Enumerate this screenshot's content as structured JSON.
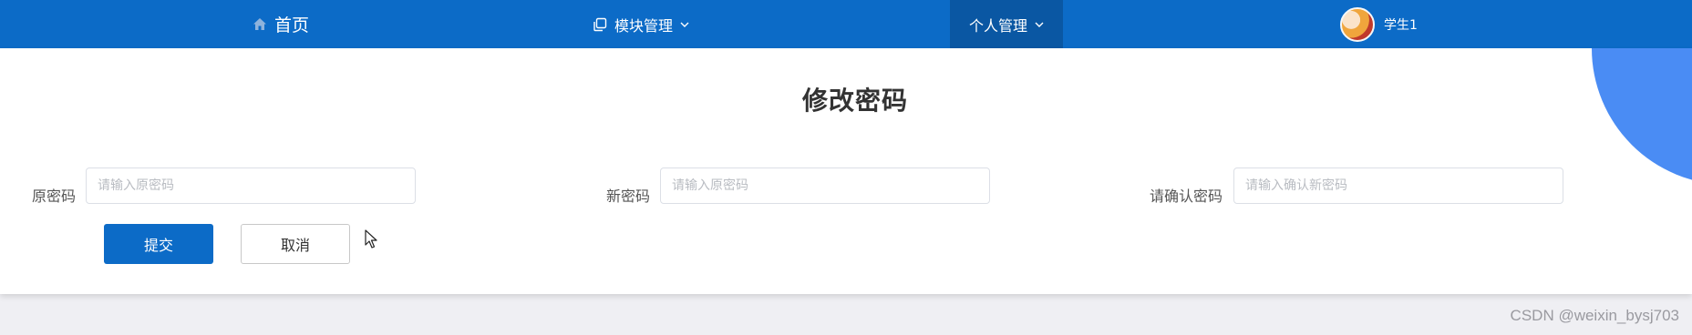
{
  "nav": {
    "home_label": "首页",
    "modules_label": "模块管理",
    "personal_label": "个人管理",
    "user_name": "学生1"
  },
  "page": {
    "title": "修改密码"
  },
  "form": {
    "old_password": {
      "label": "原密码",
      "placeholder": "请输入原密码",
      "value": ""
    },
    "new_password": {
      "label": "新密码",
      "placeholder": "请输入原密码",
      "value": ""
    },
    "confirm_password": {
      "label": "请确认密码",
      "placeholder": "请输入确认新密码",
      "value": ""
    }
  },
  "buttons": {
    "submit_label": "提交",
    "cancel_label": "取消"
  },
  "footer": {
    "watermark": "CSDN @weixin_bysj703"
  },
  "colors": {
    "nav_bg": "#0c6bc7",
    "nav_active_bg": "#0a57a3",
    "accent_circle": "#4a8cf4",
    "page_bg": "#efeff3"
  },
  "icons": {
    "home": "home-icon",
    "modules": "copy-icon",
    "dropdown": "chevron-down-icon",
    "user": "avatar"
  }
}
